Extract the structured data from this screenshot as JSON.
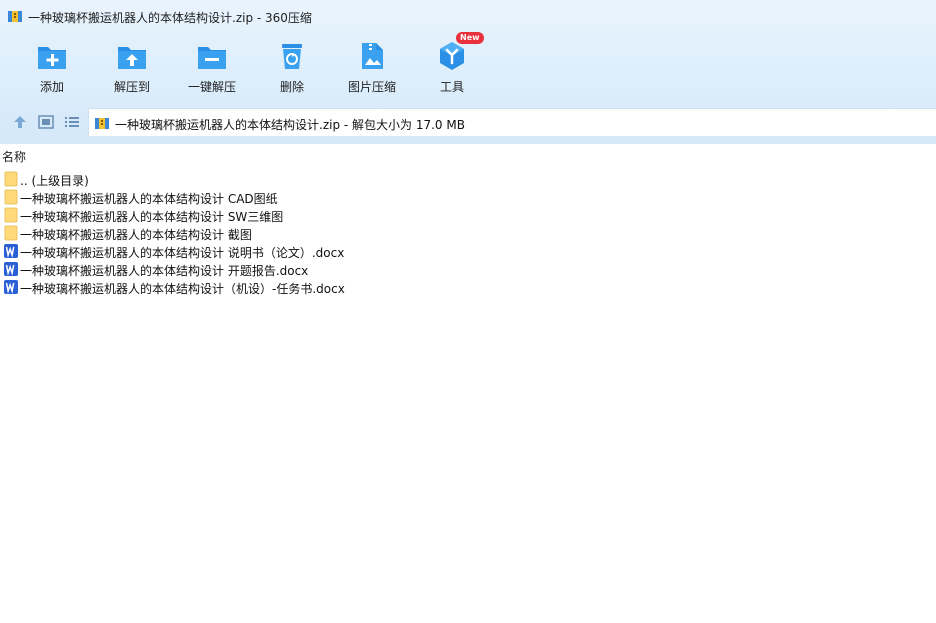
{
  "window": {
    "title": "一种玻璃杯搬运机器人的本体结构设计.zip - 360压缩"
  },
  "toolbar": {
    "items": [
      {
        "label": "添加",
        "icon": "add-icon"
      },
      {
        "label": "解压到",
        "icon": "extract-to-icon"
      },
      {
        "label": "一键解压",
        "icon": "one-click-extract-icon"
      },
      {
        "label": "删除",
        "icon": "delete-icon"
      },
      {
        "label": "图片压缩",
        "icon": "image-compress-icon"
      },
      {
        "label": "工具",
        "icon": "tools-icon",
        "badge": "New"
      }
    ]
  },
  "nav": {
    "path": "一种玻璃杯搬运机器人的本体结构设计.zip - 解包大小为 17.0 MB"
  },
  "list": {
    "header": "名称",
    "rows": [
      {
        "name": ".. (上级目录)",
        "type": "folder"
      },
      {
        "name": "一种玻璃杯搬运机器人的本体结构设计  CAD图纸",
        "type": "folder"
      },
      {
        "name": "一种玻璃杯搬运机器人的本体结构设计 SW三维图",
        "type": "folder"
      },
      {
        "name": "一种玻璃杯搬运机器人的本体结构设计 截图",
        "type": "folder"
      },
      {
        "name": "一种玻璃杯搬运机器人的本体结构设计  说明书（论文）.docx",
        "type": "word"
      },
      {
        "name": "一种玻璃杯搬运机器人的本体结构设计 开题报告.docx",
        "type": "word"
      },
      {
        "name": "一种玻璃杯搬运机器人的本体结构设计（机设）-任务书.docx",
        "type": "word"
      }
    ]
  },
  "colors": {
    "toolbar_icon": "#2b8fe6",
    "folder": "#ffd97a",
    "word": "#2b5fd6",
    "badge": "#e8313c"
  }
}
